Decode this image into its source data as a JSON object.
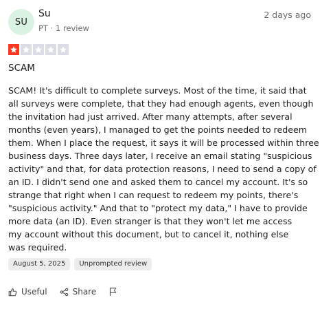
{
  "review": {
    "author": {
      "initials": "SU",
      "name": "Su",
      "meta": "PT · 1 review"
    },
    "posted_ago": "2 days ago",
    "rating": 1,
    "rating_max": 5,
    "colors": {
      "star_filled": "#ff3722",
      "star_empty": "#dcdce6",
      "avatar_bg": "#d9f2e1"
    },
    "title": "SCAM",
    "body_lines": [
      "SCAM! It's difficult to complete surveys. Most of the time, it said that",
      "all surveys were complete, that they had enough agents, even though",
      "the invitation had just arrived. After many attempts, after several",
      "months (even years), I managed to get the points needed to redeem",
      "them. When I place the request, it says it will be processed within three",
      "business days. Three days later, I receive an email stating \"suspicious",
      "activity\" and that, for data protection reasons, I need to send a copy of",
      "an ID. I didn't send one and asked them to cancel my account. It's so",
      "strange that right when I can request to redeem my points, there's",
      "\"suspicious activity.\" And that to \"protect my data,\" I have to provide",
      "more data (an ID). Even stranger is that they won't let me access",
      "my account without this document, but to cancel it, nothing else",
      "was required."
    ],
    "tags": {
      "date": "August 5, 2025",
      "type": "Unprompted review"
    },
    "actions": {
      "useful": "Useful",
      "share": "Share"
    },
    "icons": {
      "useful": "thumbs-up-icon",
      "share": "share-icon",
      "report": "flag-icon"
    }
  }
}
